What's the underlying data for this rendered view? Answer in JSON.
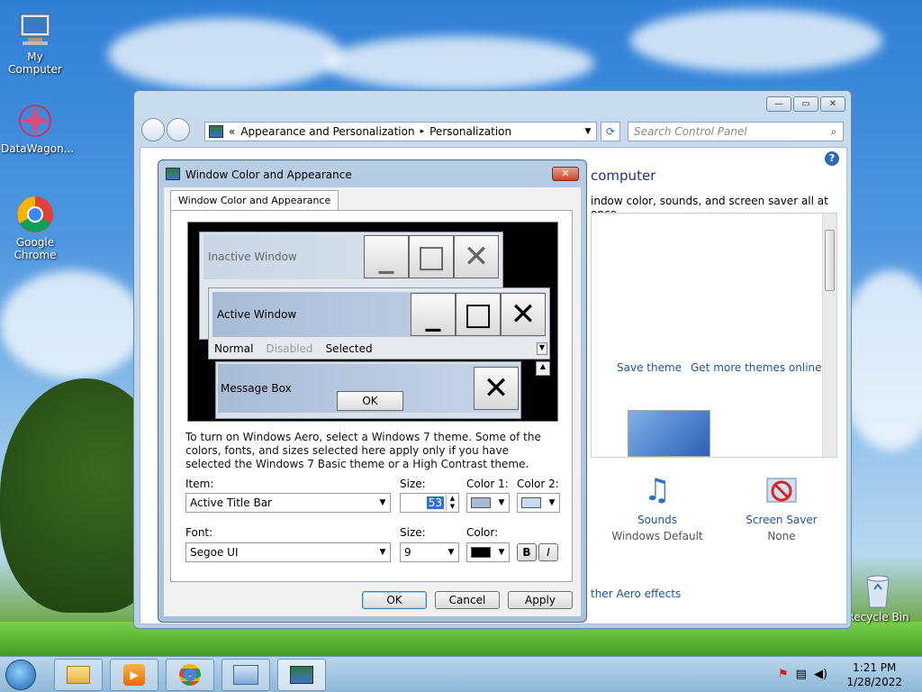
{
  "desktop": {
    "icons": [
      {
        "label": "My Computer",
        "icon": "computer-icon"
      },
      {
        "label": "DataWagon...",
        "icon": "datawagon-icon"
      },
      {
        "label": "Google Chrome",
        "icon": "chrome-icon"
      },
      {
        "label": "Recycle Bin",
        "icon": "recycle-bin-icon"
      }
    ]
  },
  "control_panel": {
    "breadcrumb": [
      "«",
      "Appearance and Personalization",
      "▸",
      "Personalization"
    ],
    "search_placeholder": "Search Control Panel",
    "heading_partial": "computer",
    "subtitle_partial": "indow color, sounds, and screen saver all at once.",
    "save_theme": "Save theme",
    "get_more_themes": "Get more themes online",
    "sounds_label": "Sounds",
    "sounds_value": "Windows Default",
    "screensaver_label": "Screen Saver",
    "screensaver_value": "None",
    "aero_link_partial": "ther Aero effects"
  },
  "dialog": {
    "title": "Window Color and Appearance",
    "close": "✕",
    "tab": "Window Color and Appearance",
    "preview": {
      "inactive": "Inactive Window",
      "active": "Active Window",
      "normal": "Normal",
      "disabled": "Disabled",
      "selected": "Selected",
      "message_box": "Message Box",
      "ok": "OK"
    },
    "description": "To turn on Windows Aero, select a Windows 7 theme.  Some of the colors, fonts, and sizes selected here apply only if you have selected the Windows 7 Basic theme or a High Contrast theme.",
    "item_label": "Item:",
    "item_value": "Active Title Bar",
    "size_label": "Size:",
    "size_value": "53",
    "color1_label": "Color 1:",
    "color2_label": "Color 2:",
    "font_label": "Font:",
    "font_value": "Segoe UI",
    "font_size_label": "Size:",
    "font_size_value": "9",
    "font_color_label": "Color:",
    "bold": "B",
    "italic": "I",
    "ok": "OK",
    "cancel": "Cancel",
    "apply": "Apply",
    "colors": {
      "color1": "#a9b9d3",
      "color2": "#c9dbef",
      "font_color": "#000000"
    }
  },
  "taskbar": {
    "time": "1:21 PM",
    "date": "1/28/2022"
  }
}
